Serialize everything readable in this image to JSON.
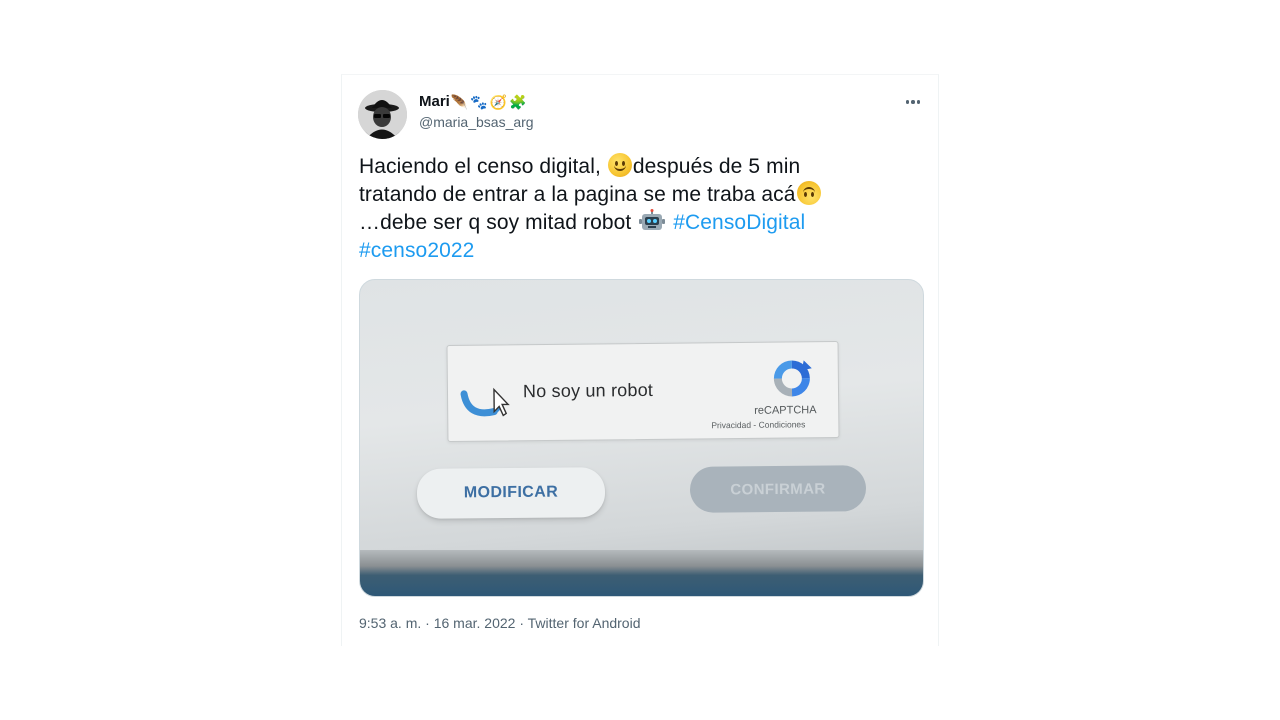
{
  "tweet": {
    "author": {
      "display_name": "Mari",
      "name_emojis": [
        "🪶",
        "🐾",
        "🧭",
        "🧩"
      ],
      "handle": "@maria_bsas_arg"
    },
    "text": {
      "part1": "Haciendo el censo digital, ",
      "part2": "después de 5 min",
      "part3": "tratando de entrar a la pagina se me traba acá",
      "part4": "…debe ser q soy mitad robot ",
      "hashtags": [
        "#CensoDigital",
        "#censo2022"
      ]
    },
    "media": {
      "captcha_label": "No soy un robot",
      "recaptcha_brand": "reCAPTCHA",
      "recaptcha_links": "Privacidad - Condiciones",
      "modify_label": "MODIFICAR",
      "confirm_label": "CONFIRMAR"
    },
    "meta": {
      "time": "9:53 a. m.",
      "separator": "·",
      "date": "16 mar. 2022",
      "source": "Twitter for Android"
    }
  },
  "colors": {
    "hashtag": "#1d9bf0",
    "secondary_text": "#536471",
    "primary_text": "#0f1419"
  }
}
